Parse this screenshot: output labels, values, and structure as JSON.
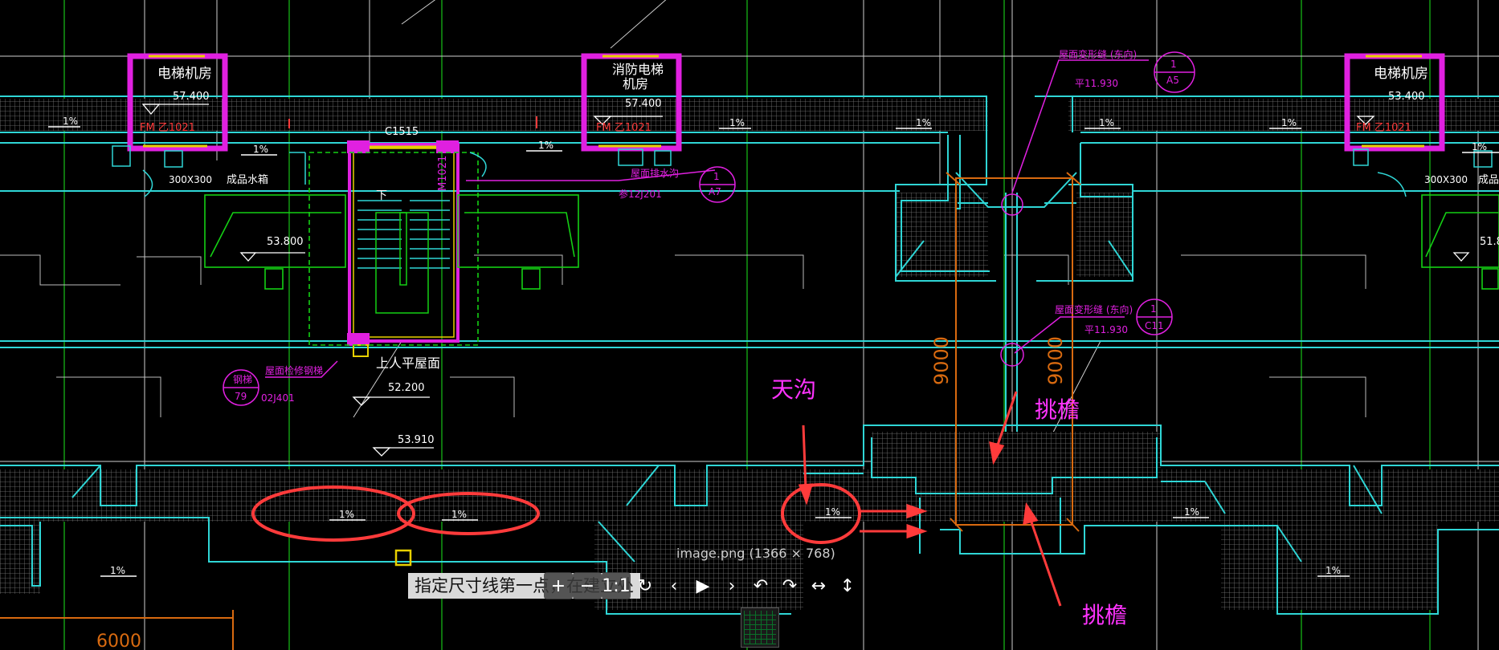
{
  "colors": {
    "grid_green": "#14a514",
    "grid_white": "#e6e6e6",
    "wall_cyan": "#2fd6d6",
    "magenta": "#e020e0",
    "orange": "#d86a10",
    "red": "#ff3b3b",
    "yellow": "#e8d000",
    "annotation_magenta": "#ff33ff"
  },
  "rooms": {
    "elevator_left": {
      "name": "电梯机房",
      "elev": "57.400",
      "door": "FM 乙1021"
    },
    "fire_elevator": {
      "name_l1": "消防电梯",
      "name_l2": "机房",
      "elev": "57.400",
      "door": "FM 乙1021"
    },
    "elevator_right": {
      "name": "电梯机房",
      "elev": "53.400",
      "door": "FM 乙1021"
    }
  },
  "labels": {
    "window_code": "C1515",
    "door_code": "M1021",
    "stair_down": "下",
    "roof_access": "上人平屋面",
    "water_tank": "成品水箱",
    "size_left": "300X300",
    "size_right": "300X300",
    "size_right_extra": "成品",
    "elev_tank": "53.800",
    "elev_tank_right": "51.8",
    "elev_roof": "52.200",
    "elev_lower": "53.910",
    "dim_9000_a": "9000",
    "dim_9000_b": "9000",
    "dim_6000": "6000",
    "slope": "1%"
  },
  "callouts": {
    "top_right": {
      "text": "屋面变形缝 (东向)",
      "sub": "平11.930",
      "num": "1",
      "ref": "A5"
    },
    "mid_right": {
      "text": "屋面变形缝 (东向)",
      "sub": "平11.930",
      "num": "1",
      "ref": "C11"
    },
    "mid_center": {
      "text": "屋面排水沟",
      "sub": "参12J201",
      "num": "1",
      "ref": "A7"
    },
    "left": {
      "text": "屋面检修钢梯",
      "sub": "02J401",
      "num": "钢梯",
      "ref": "79"
    }
  },
  "annotations": {
    "gutter": "天沟",
    "eave_upper": "挑檐",
    "eave_lower": "挑檐"
  },
  "viewer": {
    "image_info": "image.png (1366 × 768)",
    "command_prompt": "指定尺寸线第一点，在建立处",
    "one_to_one": "1:1"
  }
}
